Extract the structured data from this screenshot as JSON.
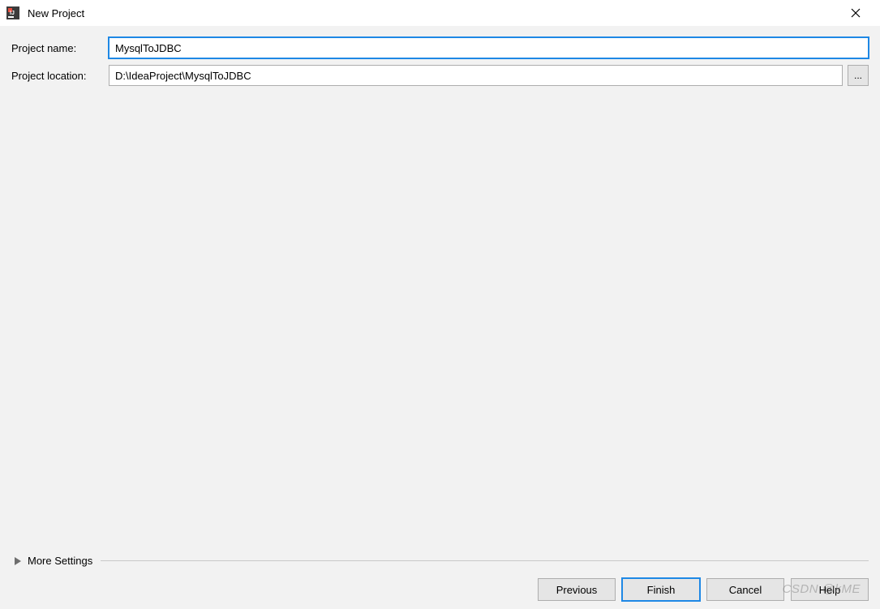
{
  "titlebar": {
    "title": "New Project"
  },
  "form": {
    "projectName": {
      "label": "Project name:",
      "value": "MysqlToJDBC"
    },
    "projectLocation": {
      "label": "Project location:",
      "value": "D:\\IdeaProject\\MysqlToJDBC",
      "browseLabel": "..."
    }
  },
  "moreSettings": {
    "label": "More Settings"
  },
  "buttons": {
    "previous": "Previous",
    "finish": "Finish",
    "cancel": "Cancel",
    "help": "Help"
  },
  "watermark": "CSDN @kME"
}
